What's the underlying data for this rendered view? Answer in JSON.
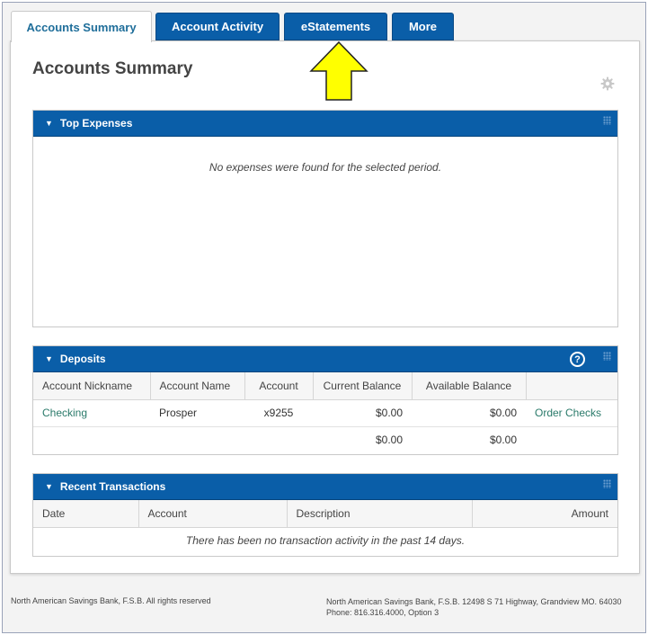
{
  "tabs": [
    {
      "label": "Accounts Summary",
      "active": true
    },
    {
      "label": "Account Activity",
      "active": false
    },
    {
      "label": "eStatements",
      "active": false
    },
    {
      "label": "More",
      "active": false
    }
  ],
  "page_title": "Accounts Summary",
  "icons": {
    "settings": "gear-icon",
    "help": "help-icon",
    "annotation": "yellow-up-arrow"
  },
  "colors": {
    "header_blue": "#0a5ea8",
    "link": "#2a7a6a",
    "annotation_yellow": "#ffff00"
  },
  "top_expenses": {
    "title": "Top Expenses",
    "empty_message": "No expenses were found for the selected period."
  },
  "deposits": {
    "title": "Deposits",
    "help_label": "?",
    "columns": [
      "Account Nickname",
      "Account Name",
      "Account",
      "Current Balance",
      "Available Balance",
      ""
    ],
    "rows": [
      {
        "nickname": "Checking",
        "name": "Prosper",
        "account": "x9255",
        "current": "$0.00",
        "available": "$0.00",
        "action": "Order Checks"
      }
    ],
    "totals": {
      "current": "$0.00",
      "available": "$0.00"
    }
  },
  "recent_transactions": {
    "title": "Recent Transactions",
    "columns": [
      "Date",
      "Account",
      "Description",
      "Amount"
    ],
    "empty_message": "There has been no transaction activity in the past 14 days."
  },
  "footer": {
    "left": "North American Savings Bank, F.S.B. All rights reserved",
    "right_line1": "North American Savings Bank, F.S.B. 12498 S 71 Highway, Grandview MO. 64030",
    "right_line2": "Phone: 816.316.4000, Option 3"
  }
}
